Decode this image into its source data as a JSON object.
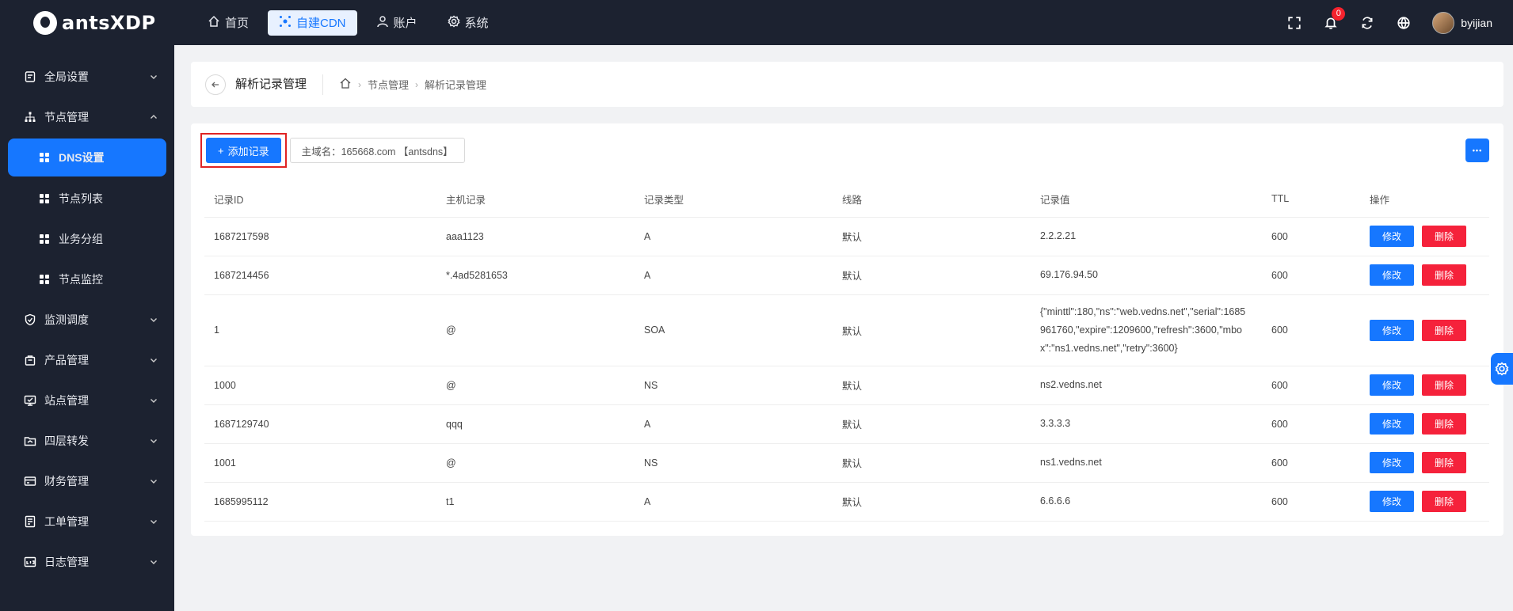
{
  "brand": {
    "name": "antsXDP"
  },
  "nav": [
    {
      "label": "首页",
      "icon": "home-icon"
    },
    {
      "label": "自建CDN",
      "icon": "cdn-icon",
      "active": true
    },
    {
      "label": "账户",
      "icon": "user-icon"
    },
    {
      "label": "系统",
      "icon": "gear-icon"
    }
  ],
  "topbar": {
    "notification_count": "0",
    "username": "byijian"
  },
  "sidebar": {
    "groups": [
      {
        "label": "全局设置"
      },
      {
        "label": "节点管理",
        "expanded": true
      },
      {
        "label": "监测调度"
      },
      {
        "label": "产品管理"
      },
      {
        "label": "站点管理"
      },
      {
        "label": "四层转发"
      },
      {
        "label": "财务管理"
      },
      {
        "label": "工单管理"
      },
      {
        "label": "日志管理"
      }
    ],
    "sub_items": [
      {
        "label": "DNS设置",
        "active": true
      },
      {
        "label": "节点列表"
      },
      {
        "label": "业务分组"
      },
      {
        "label": "节点监控"
      }
    ]
  },
  "header": {
    "title": "解析记录管理",
    "breadcrumb": [
      "节点管理",
      "解析记录管理"
    ]
  },
  "toolbar": {
    "add_label": "添加记录",
    "domain_label": "主域名：165668.com 【antsdns】",
    "more_label": "•••"
  },
  "table": {
    "columns": [
      "记录ID",
      "主机记录",
      "记录类型",
      "线路",
      "记录值",
      "TTL",
      "操作"
    ],
    "edit_label": "修改",
    "delete_label": "删除",
    "rows": [
      {
        "id": "1687217598",
        "host": "aaa1123",
        "type": "A",
        "line": "默认",
        "value": "2.2.2.21",
        "ttl": "600"
      },
      {
        "id": "1687214456",
        "host": "*.4ad5281653",
        "type": "A",
        "line": "默认",
        "value": "69.176.94.50",
        "ttl": "600"
      },
      {
        "id": "1",
        "host": "@",
        "type": "SOA",
        "line": "默认",
        "value": "{\"minttl\":180,\"ns\":\"web.vedns.net\",\"serial\":1685961760,\"expire\":1209600,\"refresh\":3600,\"mbox\":\"ns1.vedns.net\",\"retry\":3600}",
        "ttl": "600"
      },
      {
        "id": "1000",
        "host": "@",
        "type": "NS",
        "line": "默认",
        "value": "ns2.vedns.net",
        "ttl": "600"
      },
      {
        "id": "1687129740",
        "host": "qqq",
        "type": "A",
        "line": "默认",
        "value": "3.3.3.3",
        "ttl": "600"
      },
      {
        "id": "1001",
        "host": "@",
        "type": "NS",
        "line": "默认",
        "value": "ns1.vedns.net",
        "ttl": "600"
      },
      {
        "id": "1685995112",
        "host": "t1",
        "type": "A",
        "line": "默认",
        "value": "6.6.6.6",
        "ttl": "600"
      }
    ]
  },
  "colors": {
    "primary": "#1677ff",
    "danger": "#f5223b",
    "dark": "#1c2230"
  }
}
